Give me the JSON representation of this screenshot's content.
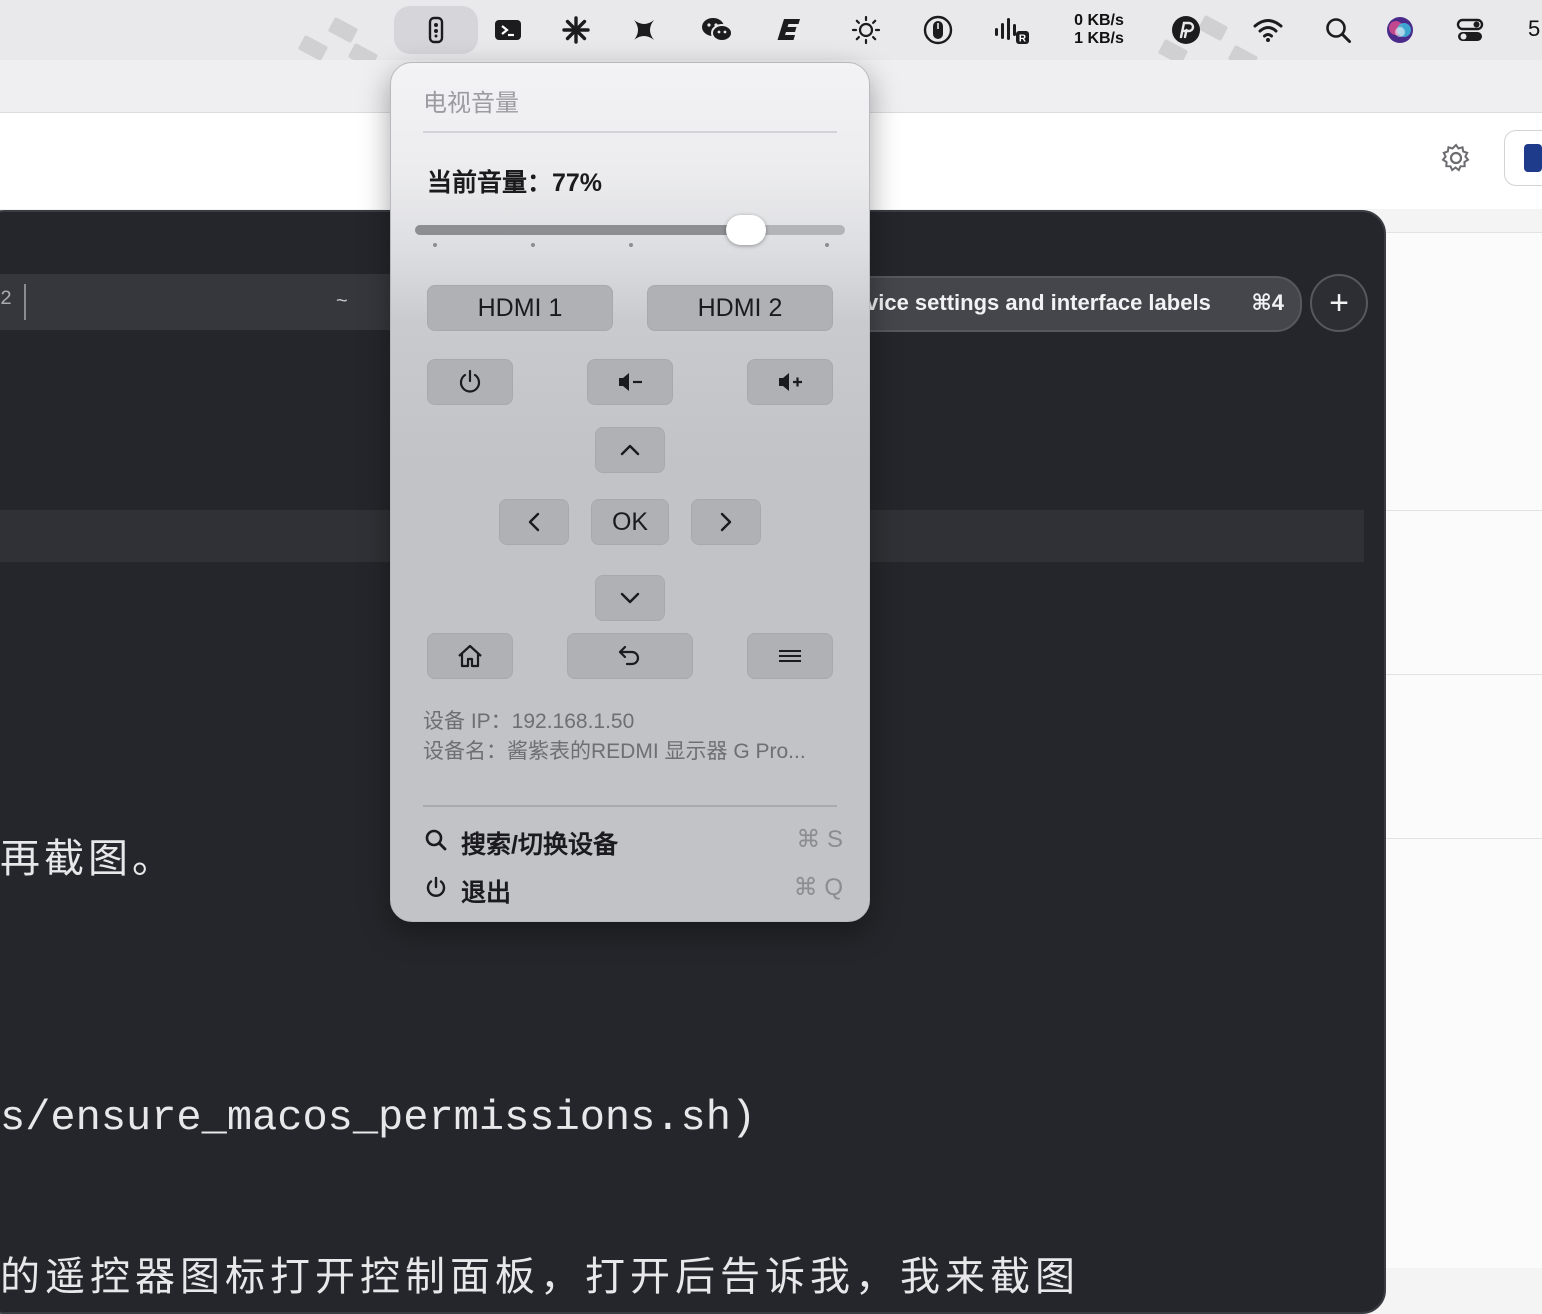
{
  "menubar": {
    "net_up": "0 KB/s",
    "net_down": "1 KB/s",
    "edge_char": "5",
    "icons": [
      "remote-icon",
      "terminal-app-icon",
      "asterisk-icon",
      "knot-app-icon",
      "wechat-icon",
      "e-app-icon",
      "brightness-icon",
      "mouse-icon",
      "audio-meter-icon",
      "network-speed",
      "pp-app-icon",
      "wifi-icon",
      "spotlight-icon",
      "siri-icon",
      "control-center-icon"
    ]
  },
  "terminal": {
    "tab_num": "2",
    "tab_tilde": "~",
    "active_tab_label": "vice settings and interface labels",
    "active_tab_shortcut": "⌘4",
    "new_tab_symbol": "+",
    "line1": "再截图。",
    "line2": "s/ensure_macos_permissions.sh)",
    "line3": "的遥控器图标打开控制面板，打开后告诉我，我来截图"
  },
  "panel": {
    "title": "电视音量",
    "volume_label": "当前音量：77%",
    "volume_value": 0.77,
    "hdmi1": "HDMI 1",
    "hdmi2": "HDMI 2",
    "ok": "OK",
    "device_ip": "设备 IP：192.168.1.50",
    "device_name": "设备名：酱紫表的REDMI 显示器 G Pro...",
    "menu": {
      "search_label": "搜索/切换设备",
      "search_shortcut": "⌘ S",
      "quit_label": "退出",
      "quit_shortcut": "⌘ Q"
    }
  }
}
